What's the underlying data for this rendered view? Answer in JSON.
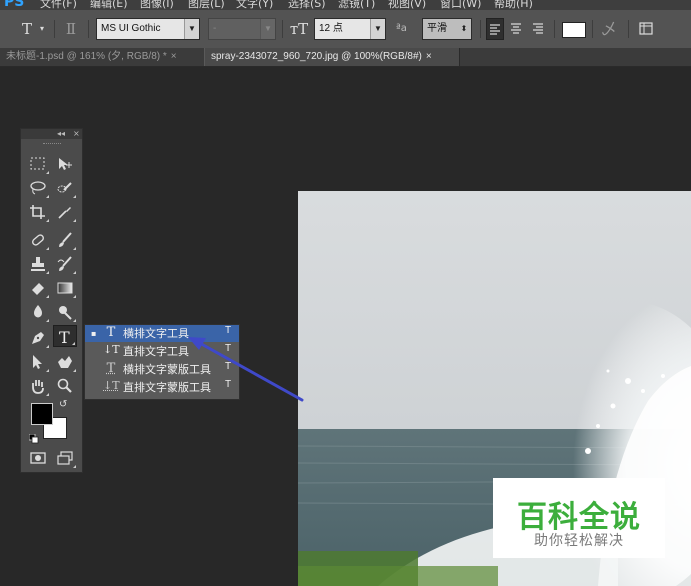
{
  "app": {
    "logo": "PS"
  },
  "menu": [
    "文件(F)",
    "编辑(E)",
    "图像(I)",
    "图层(L)",
    "文字(Y)",
    "选择(S)",
    "滤镜(T)",
    "视图(V)",
    "窗口(W)",
    "帮助(H)"
  ],
  "options": {
    "font_family": "MS UI Gothic",
    "font_style": "-",
    "font_size": "12 点",
    "aa_label": "ªa",
    "antialias": "平滑",
    "color_swatch": "#ffffff"
  },
  "tabs": [
    {
      "label": "未标题-1.psd @ 161% (夕, RGB/8) *",
      "close": "×",
      "active": false
    },
    {
      "label": "spray-2343072_960_720.jpg @ 100%(RGB/8#)",
      "close": "×",
      "active": true
    }
  ],
  "toolbox": {
    "collapse": "◂◂",
    "close": "×"
  },
  "flyout": {
    "items": [
      {
        "icon": "T",
        "label": "横排文字工具",
        "shortcut": "T",
        "current": true
      },
      {
        "icon": "↓T",
        "label": "直排文字工具",
        "shortcut": "T",
        "current": false
      },
      {
        "icon": "T",
        "label": "横排文字蒙版工具",
        "shortcut": "T",
        "current": false
      },
      {
        "icon": "↓T",
        "label": "直排文字蒙版工具",
        "shortcut": "T",
        "current": false
      }
    ],
    "current_marker": "▪"
  },
  "watermark": {
    "title": "百科全说",
    "subtitle": "助你轻松解决"
  },
  "colors": {
    "highlight": "#3a64a8",
    "arrow": "#3f49c9",
    "accent": "#3cae3c"
  }
}
